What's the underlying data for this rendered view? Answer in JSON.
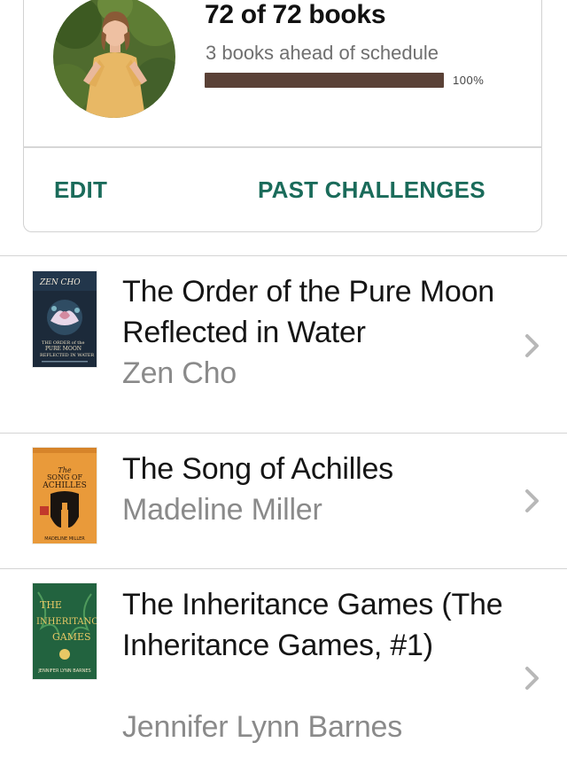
{
  "challenge": {
    "progress_count": "72 of 72 books",
    "schedule_status": "3 books ahead of schedule",
    "progress_fraction": 1.0,
    "progress_percent_label": "100%",
    "progress_fill_color": "#5a4136",
    "edit_label": "EDIT",
    "past_challenges_label": "PAST CHALLENGES",
    "accent_color": "#1a6b5a"
  },
  "books": [
    {
      "title": "The Order of the Pure Moon Reflected in Water",
      "author": "Zen Cho",
      "cover_icon": "book-cover",
      "chevron_icon": "chevron-right-icon"
    },
    {
      "title": "The Song of Achilles",
      "author": "Madeline Miller",
      "cover_icon": "book-cover",
      "chevron_icon": "chevron-right-icon"
    },
    {
      "title": "The Inheritance Games (The Inheritance Games, #1)",
      "author": "Jennifer Lynn Barnes",
      "cover_icon": "book-cover",
      "chevron_icon": "chevron-right-icon"
    }
  ]
}
